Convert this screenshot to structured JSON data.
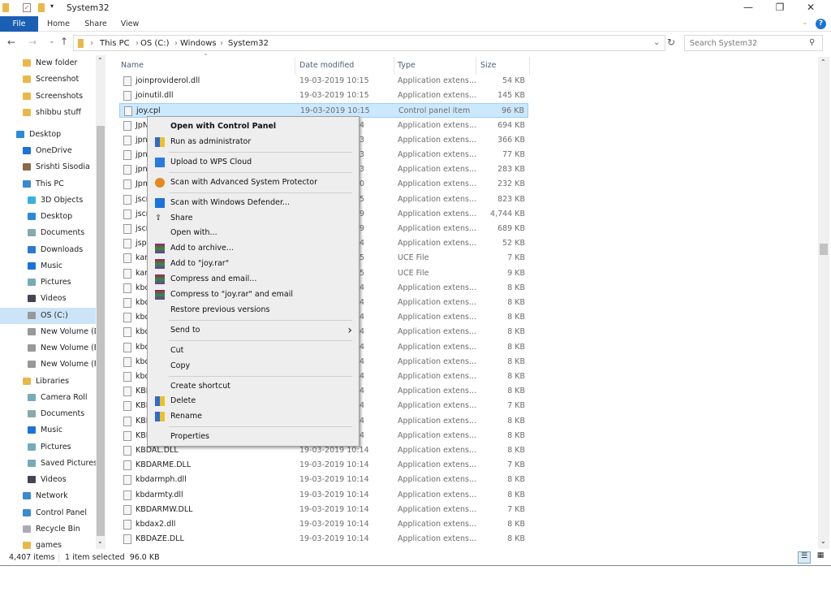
{
  "window": {
    "title": "System32"
  },
  "ribbon": {
    "tabs": [
      "File",
      "Home",
      "Share",
      "View"
    ]
  },
  "address": {
    "crumbs": [
      "This PC",
      "OS (C:)",
      "Windows",
      "System32"
    ]
  },
  "search": {
    "placeholder": "Search System32"
  },
  "sidebar": {
    "items": [
      {
        "label": "New folder",
        "icon": "folder-icon",
        "indent": 1
      },
      {
        "label": "Screenshot",
        "icon": "folder-icon",
        "indent": 1
      },
      {
        "label": "Screenshots",
        "icon": "folder-icon",
        "indent": 1
      },
      {
        "label": "shibbu stuff",
        "icon": "folder-icon",
        "indent": 1
      },
      {
        "label": "Desktop",
        "icon": "desktop-icon",
        "indent": 0
      },
      {
        "label": "OneDrive",
        "icon": "cloud-icon",
        "indent": 1
      },
      {
        "label": "Srishti Sisodia",
        "icon": "user-icon",
        "indent": 1
      },
      {
        "label": "This PC",
        "icon": "computer-icon",
        "indent": 1
      },
      {
        "label": "3D Objects",
        "icon": "cube-icon",
        "indent": 2
      },
      {
        "label": "Desktop",
        "icon": "desktop-icon",
        "indent": 2
      },
      {
        "label": "Documents",
        "icon": "document-icon",
        "indent": 2
      },
      {
        "label": "Downloads",
        "icon": "download-icon",
        "indent": 2
      },
      {
        "label": "Music",
        "icon": "music-icon",
        "indent": 2
      },
      {
        "label": "Pictures",
        "icon": "picture-icon",
        "indent": 2
      },
      {
        "label": "Videos",
        "icon": "video-icon",
        "indent": 2
      },
      {
        "label": "OS (C:)",
        "icon": "drive-icon",
        "indent": 2,
        "selected": true
      },
      {
        "label": "New Volume (D",
        "icon": "drive-icon",
        "indent": 2
      },
      {
        "label": "New Volume (E",
        "icon": "drive-icon",
        "indent": 2
      },
      {
        "label": "New Volume (F",
        "icon": "drive-icon",
        "indent": 2
      },
      {
        "label": "Libraries",
        "icon": "library-icon",
        "indent": 1
      },
      {
        "label": "Camera Roll",
        "icon": "picture-icon",
        "indent": 2
      },
      {
        "label": "Documents",
        "icon": "document-icon",
        "indent": 2
      },
      {
        "label": "Music",
        "icon": "music-icon",
        "indent": 2
      },
      {
        "label": "Pictures",
        "icon": "picture-icon",
        "indent": 2
      },
      {
        "label": "Saved Pictures",
        "icon": "picture-icon",
        "indent": 2
      },
      {
        "label": "Videos",
        "icon": "video-icon",
        "indent": 2
      },
      {
        "label": "Network",
        "icon": "network-icon",
        "indent": 1
      },
      {
        "label": "Control Panel",
        "icon": "control-panel-icon",
        "indent": 1
      },
      {
        "label": "Recycle Bin",
        "icon": "recycle-bin-icon",
        "indent": 1
      },
      {
        "label": "games",
        "icon": "folder-icon",
        "indent": 1
      }
    ]
  },
  "columns": {
    "name": "Name",
    "date": "Date modified",
    "type": "Type",
    "size": "Size"
  },
  "files": [
    {
      "name": "joinproviderol.dll",
      "date": "19-03-2019 10:15",
      "type": "Application extens...",
      "size": "54 KB"
    },
    {
      "name": "joinutil.dll",
      "date": "19-03-2019 10:15",
      "type": "Application extens...",
      "size": "145 KB"
    },
    {
      "name": "joy.cpl",
      "date": "19-03-2019 10:15",
      "type": "Control panel item",
      "size": "96 KB",
      "selected": true
    },
    {
      "name": "JpN",
      "date_tail": "4",
      "type": "Application extens...",
      "size": "694 KB"
    },
    {
      "name": "jpn",
      "date_tail": "3",
      "type": "Application extens...",
      "size": "366 KB"
    },
    {
      "name": "jpn",
      "date_tail": "3",
      "type": "Application extens...",
      "size": "77 KB"
    },
    {
      "name": "jpn",
      "date_tail": "3",
      "type": "Application extens...",
      "size": "283 KB"
    },
    {
      "name": "Jpn",
      "date_tail": "0",
      "type": "Application extens...",
      "size": "232 KB"
    },
    {
      "name": "jscr",
      "date_tail": "5",
      "type": "Application extens...",
      "size": "823 KB"
    },
    {
      "name": "jscr",
      "date_tail": "9",
      "type": "Application extens...",
      "size": "4,744 KB"
    },
    {
      "name": "jscr",
      "date_tail": "9",
      "type": "Application extens...",
      "size": "689 KB"
    },
    {
      "name": "jspr",
      "date_tail": "4",
      "type": "Application extens...",
      "size": "52 KB"
    },
    {
      "name": "kan",
      "date_tail": "5",
      "type": "UCE File",
      "size": "7 KB",
      "plain": true
    },
    {
      "name": "kan",
      "date_tail": "5",
      "type": "UCE File",
      "size": "9 KB",
      "plain": true
    },
    {
      "name": "kbd",
      "date_tail": "4",
      "type": "Application extens...",
      "size": "8 KB"
    },
    {
      "name": "kbd",
      "date_tail": "4",
      "type": "Application extens...",
      "size": "8 KB"
    },
    {
      "name": "kbd",
      "date_tail": "4",
      "type": "Application extens...",
      "size": "8 KB"
    },
    {
      "name": "kbd",
      "date_tail": "4",
      "type": "Application extens...",
      "size": "8 KB"
    },
    {
      "name": "kbd",
      "date_tail": "4",
      "type": "Application extens...",
      "size": "8 KB"
    },
    {
      "name": "kbd",
      "date_tail": "4",
      "type": "Application extens...",
      "size": "8 KB"
    },
    {
      "name": "kbd",
      "date_tail": "4",
      "type": "Application extens...",
      "size": "8 KB"
    },
    {
      "name": "KBI",
      "date_tail": "4",
      "type": "Application extens...",
      "size": "8 KB"
    },
    {
      "name": "KBI",
      "date_tail": "4",
      "type": "Application extens...",
      "size": "7 KB"
    },
    {
      "name": "KBI",
      "date_tail": "4",
      "type": "Application extens...",
      "size": "8 KB"
    },
    {
      "name": "KBI",
      "date_tail": "4",
      "type": "Application extens...",
      "size": "8 KB"
    },
    {
      "name": "KBDAL.DLL",
      "date": "19-03-2019 10:14",
      "type": "Application extens...",
      "size": "8 KB"
    },
    {
      "name": "KBDARME.DLL",
      "date": "19-03-2019 10:14",
      "type": "Application extens...",
      "size": "7 KB"
    },
    {
      "name": "kbdarmph.dll",
      "date": "19-03-2019 10:14",
      "type": "Application extens...",
      "size": "8 KB"
    },
    {
      "name": "kbdarmty.dll",
      "date": "19-03-2019 10:14",
      "type": "Application extens...",
      "size": "8 KB"
    },
    {
      "name": "KBDARMW.DLL",
      "date": "19-03-2019 10:14",
      "type": "Application extens...",
      "size": "7 KB"
    },
    {
      "name": "kbdax2.dll",
      "date": "19-03-2019 10:14",
      "type": "Application extens...",
      "size": "8 KB"
    },
    {
      "name": "KBDAZE.DLL",
      "date": "19-03-2019 10:14",
      "type": "Application extens...",
      "size": "8 KB"
    }
  ],
  "context_menu": {
    "items": [
      {
        "label": "Open with Control Panel",
        "bold": true
      },
      {
        "label": "Run as administrator",
        "icon": "shield-icon"
      },
      {
        "sep": true
      },
      {
        "label": "Upload to WPS Cloud",
        "icon": "wps-cloud-icon"
      },
      {
        "sep": true
      },
      {
        "label": "Scan with Advanced System Protector",
        "icon": "protector-icon"
      },
      {
        "sep": true
      },
      {
        "label": "Scan with Windows Defender...",
        "icon": "defender-icon"
      },
      {
        "label": "Share",
        "icon": "share-icon"
      },
      {
        "label": "Open with..."
      },
      {
        "label": "Add to archive...",
        "icon": "winrar-icon"
      },
      {
        "label": "Add to \"joy.rar\"",
        "icon": "winrar-icon"
      },
      {
        "label": "Compress and email...",
        "icon": "winrar-icon"
      },
      {
        "label": "Compress to \"joy.rar\" and email",
        "icon": "winrar-icon"
      },
      {
        "label": "Restore previous versions"
      },
      {
        "sep": true
      },
      {
        "label": "Send to",
        "submenu": true
      },
      {
        "sep": true
      },
      {
        "label": "Cut"
      },
      {
        "label": "Copy"
      },
      {
        "sep": true
      },
      {
        "label": "Create shortcut"
      },
      {
        "label": "Delete",
        "icon": "shield-icon"
      },
      {
        "label": "Rename",
        "icon": "shield-icon"
      },
      {
        "sep": true
      },
      {
        "label": "Properties"
      }
    ]
  },
  "status": {
    "count": "4,407 items",
    "selection": "1 item selected  96.0 KB"
  },
  "colors": {
    "accent": "#1a5fb4",
    "selection": "#cce8ff",
    "menu_bg": "#eeeeee"
  }
}
